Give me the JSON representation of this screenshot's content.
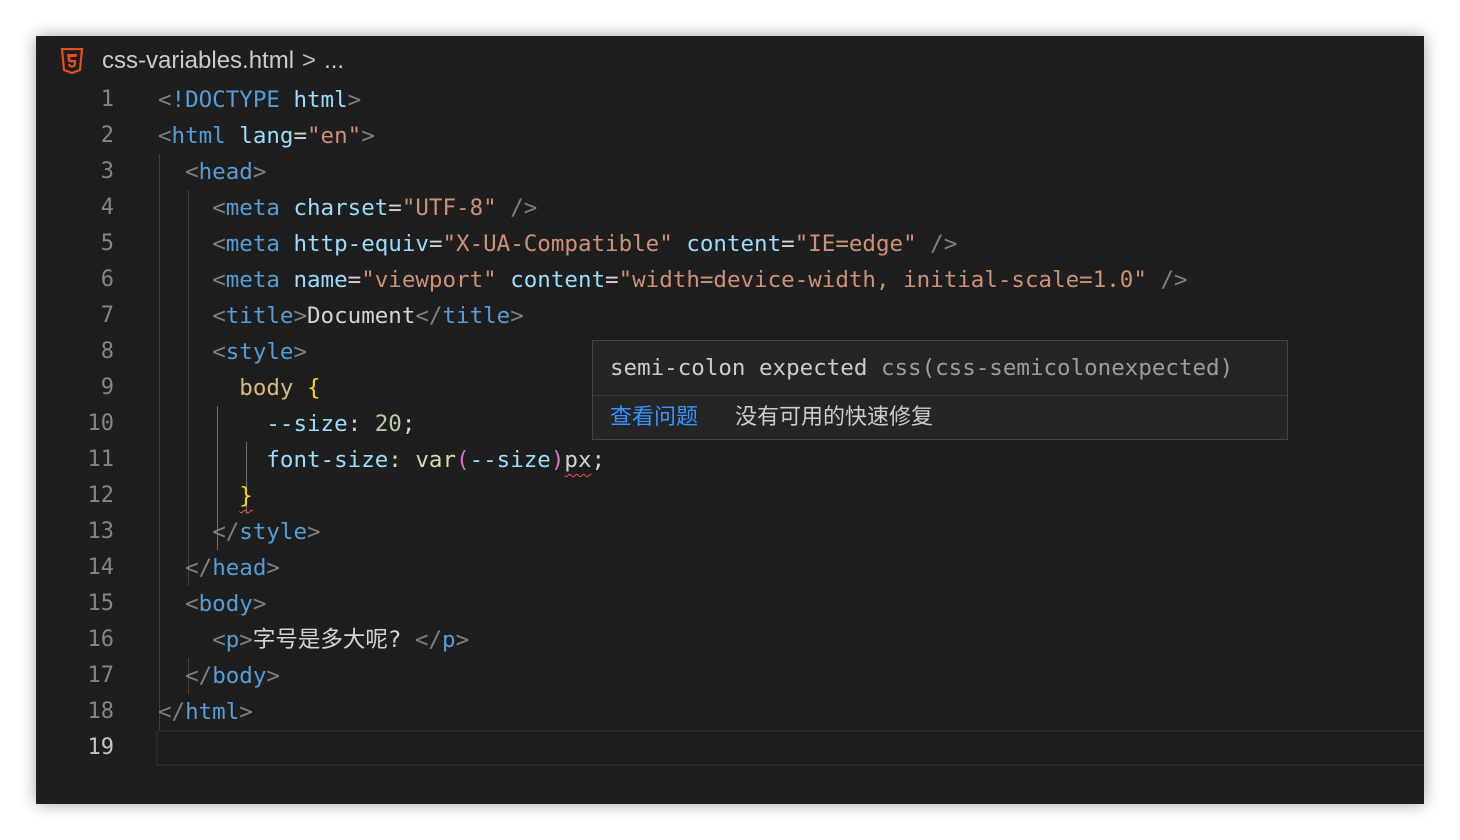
{
  "breadcrumb": {
    "icon": "html5-icon",
    "file": "css-variables.html",
    "separator": ">",
    "more": "..."
  },
  "line_numbers": [
    "1",
    "2",
    "3",
    "4",
    "5",
    "6",
    "7",
    "8",
    "9",
    "10",
    "11",
    "12",
    "13",
    "14",
    "15",
    "16",
    "17",
    "18",
    "19"
  ],
  "active_line": "19",
  "code": {
    "l1": {
      "open": "<",
      "doctype": "!DOCTYPE",
      "html": "html",
      "close": ">"
    },
    "l2": {
      "open": "<",
      "tag": "html",
      "attr": "lang",
      "eq": "=",
      "val": "\"en\"",
      "close": ">"
    },
    "l3": {
      "open": "<",
      "tag": "head",
      "close": ">"
    },
    "l4": {
      "open": "<",
      "tag": "meta",
      "attr": "charset",
      "eq": "=",
      "val": "\"UTF-8\"",
      "close": "/>"
    },
    "l5": {
      "open": "<",
      "tag": "meta",
      "attr1": "http-equiv",
      "eq": "=",
      "val1": "\"X-UA-Compatible\"",
      "attr2": "content",
      "val2": "\"IE=edge\"",
      "close": "/>"
    },
    "l6": {
      "open": "<",
      "tag": "meta",
      "attr1": "name",
      "eq": "=",
      "val1": "\"viewport\"",
      "attr2": "content",
      "val2": "\"width=device-width, initial-scale=1.0\"",
      "close": "/>"
    },
    "l7": {
      "open": "<",
      "tag": "title",
      "close": ">",
      "text": "Document",
      "endopen": "</",
      "endtag": "title"
    },
    "l8": {
      "open": "<",
      "tag": "style",
      "close": ">"
    },
    "l9": {
      "selector": "body",
      "brace": "{"
    },
    "l10": {
      "prop": "--size",
      "colon": ":",
      "value": "20",
      "semi": ";"
    },
    "l11": {
      "prop": "font-size",
      "colon": ":",
      "fn": "var",
      "paren_open": "(",
      "arg": "--size",
      "paren_close": ")",
      "unit": "px",
      "semi": ";"
    },
    "l12": {
      "brace": "}"
    },
    "l13": {
      "open": "</",
      "tag": "style",
      "close": ">"
    },
    "l14": {
      "open": "</",
      "tag": "head",
      "close": ">"
    },
    "l15": {
      "open": "<",
      "tag": "body",
      "close": ">"
    },
    "l16": {
      "open": "<",
      "tag": "p",
      "close": ">",
      "text": "字号是多大呢? ",
      "endopen": "</",
      "endtag": "p"
    },
    "l17": {
      "open": "</",
      "tag": "body",
      "close": ">"
    },
    "l18": {
      "open": "</",
      "tag": "html",
      "close": ">"
    }
  },
  "hover": {
    "message": "semi-colon expected",
    "source": "css(css-semicolonexpected)",
    "view_problem": "查看问题",
    "no_quick_fix": "没有可用的快速修复"
  },
  "colors": {
    "background": "#1e1e1e",
    "tag": "#569cd6",
    "attribute": "#9cdcfe",
    "string": "#ce9178",
    "selector": "#d7ba7d",
    "number": "#b5cea8",
    "error": "#f14c4c",
    "link": "#3794ff"
  }
}
